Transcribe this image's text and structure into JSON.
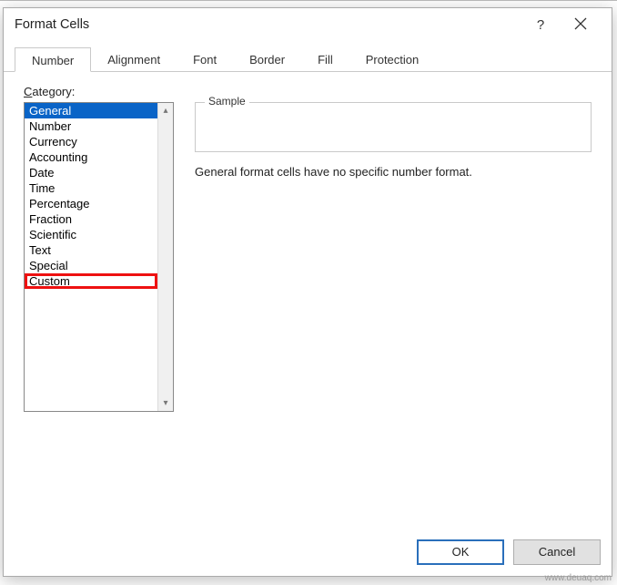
{
  "dialog": {
    "title": "Format Cells",
    "help_symbol": "?"
  },
  "tabs": [
    {
      "label": "Number"
    },
    {
      "label": "Alignment"
    },
    {
      "label": "Font"
    },
    {
      "label": "Border"
    },
    {
      "label": "Fill"
    },
    {
      "label": "Protection"
    }
  ],
  "category": {
    "label_prefix": "C",
    "label_rest": "ategory:",
    "items": [
      "General",
      "Number",
      "Currency",
      "Accounting",
      "Date",
      "Time",
      "Percentage",
      "Fraction",
      "Scientific",
      "Text",
      "Special",
      "Custom"
    ],
    "selected_index": 0,
    "highlight_index": 11
  },
  "sample": {
    "label": "Sample",
    "value": ""
  },
  "description": "General format cells have no specific number format.",
  "buttons": {
    "ok": "OK",
    "cancel": "Cancel"
  },
  "watermark": "www.deuaq.com",
  "scroll": {
    "up": "▴",
    "down": "▾"
  }
}
